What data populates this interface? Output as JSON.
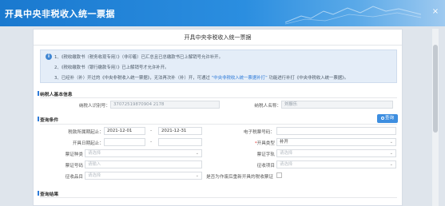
{
  "window": {
    "title": "开具中央非税收入统一票据",
    "close_glyph": "×"
  },
  "page": {
    "title": "开具中央非税收入统一票据"
  },
  "notice": {
    "line1": "1、《税收缴款书（税务收现专用）》（非印着）已汇总且已总缴款书已上解销号允许补开。",
    "line2": "2、《税收缴款书（银行缴款专用）》已上解销号才允许补开。",
    "line3_a": "3、已经补（补）开过的《中央非税收入统一票据》，无法再次补（补）开，可通过 ",
    "line3_link": "“中央非税收入统一票据补打”",
    "line3_b": " 功能进行补打《中央非税收入统一票据》。"
  },
  "taxpayer": {
    "section_label": "纳税人基本信息",
    "id_label": "纳税人识别号：",
    "id_value": "37072519870904 2178",
    "name_label": "纳税人名称：",
    "name_value": "刘振乐"
  },
  "query": {
    "section_label": "查询条件",
    "button_label": "查询",
    "period_label": "税款所属期起止：",
    "period_from": "2021-12-01",
    "period_to": "2021-12-31",
    "range_sep": "-",
    "evoucher_label": "电子税票号码：",
    "issue_date_label": "开具日期起止：",
    "issue_type_label": "开具类型",
    "issue_type_value": "补开",
    "voucher_type_label": "票证种类",
    "voucher_char_label": "票证字轨",
    "voucher_no_label": "票证号码",
    "item_label": "征收项目",
    "subitem_label": "征收品目",
    "reissue_label": "是否为作废后重新开具的税收票证",
    "placeholder_select": "请选择",
    "placeholder_input": "请输入"
  },
  "results": {
    "section_label": "查询结果"
  }
}
